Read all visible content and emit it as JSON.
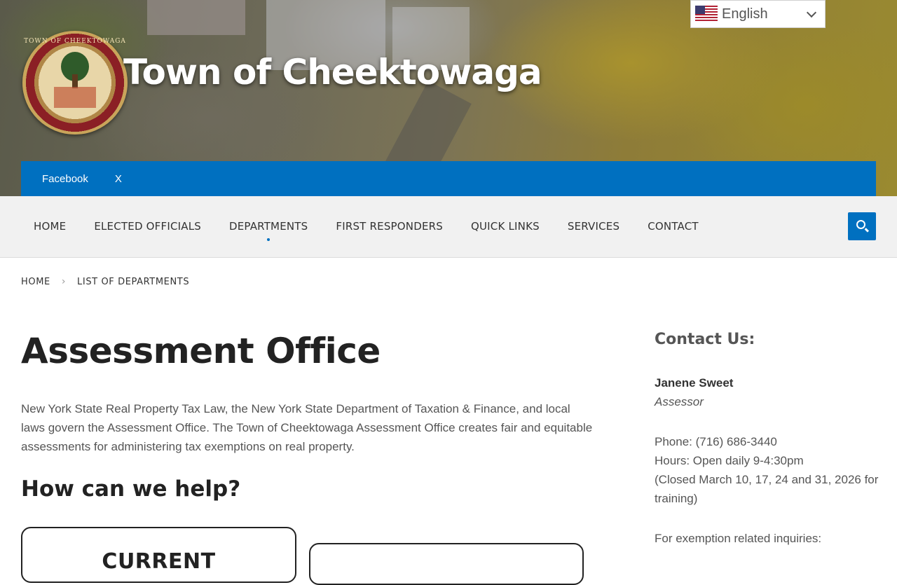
{
  "header": {
    "site_title": "Town of Cheektowaga",
    "seal_text": "TOWN OF CHEEKTOWAGA",
    "language": "English"
  },
  "social": {
    "facebook": "Facebook",
    "x": "X"
  },
  "nav": {
    "items": [
      {
        "label": "HOME"
      },
      {
        "label": "ELECTED OFFICIALS"
      },
      {
        "label": "DEPARTMENTS"
      },
      {
        "label": "FIRST RESPONDERS"
      },
      {
        "label": "QUICK LINKS"
      },
      {
        "label": "SERVICES"
      },
      {
        "label": "CONTACT"
      }
    ],
    "active": "DEPARTMENTS"
  },
  "breadcrumb": {
    "home": "HOME",
    "current": "LIST OF DEPARTMENTS"
  },
  "main": {
    "title": "Assessment Office",
    "intro": "New York State Real Property Tax Law, the New York State Department of Taxation & Finance, and local laws govern the Assessment Office. The Town of Cheektowaga Assessment Office creates fair and equitable assessments for administering tax exemptions on real property.",
    "help_heading": "How can we help?",
    "cards": [
      {
        "title": "CURRENT"
      },
      {
        "title": ""
      }
    ]
  },
  "sidebar": {
    "heading": "Contact Us:",
    "name": "Janene Sweet",
    "role": "Assessor",
    "phone": "Phone: (716) 686-3440",
    "hours": "Hours: Open daily 9-4:30pm",
    "closed": "(Closed March 10, 17, 24 and 31, 2026 for training)",
    "exemption": "For exemption related inquiries:"
  },
  "colors": {
    "accent": "#0070c0",
    "nav_bg": "#f1f1f1",
    "text": "#555555",
    "heading": "#222222"
  }
}
